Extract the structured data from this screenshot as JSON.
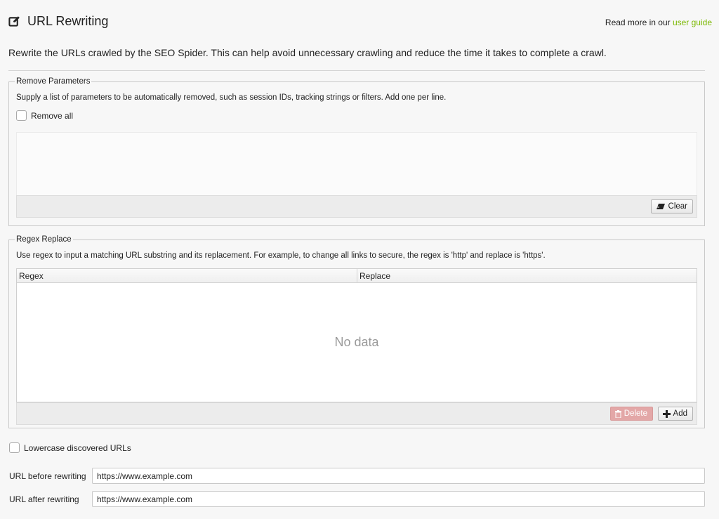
{
  "header": {
    "title": "URL Rewriting",
    "title_icon": "edit-icon",
    "read_more_prefix": "Read more in our ",
    "read_more_link": "user guide",
    "link_color": "#7ab800"
  },
  "intro": "Rewrite the URLs crawled by the SEO Spider. This can help avoid unnecessary crawling and reduce the time it takes to complete a crawl.",
  "remove_parameters": {
    "legend": "Remove Parameters",
    "description": "Supply a list of parameters to be automatically removed, such as session IDs, tracking strings or filters. Add one per line.",
    "remove_all_label": "Remove all",
    "remove_all_checked": false,
    "textarea_value": "",
    "clear_label": "Clear",
    "clear_icon": "eraser-icon"
  },
  "regex_replace": {
    "legend": "Regex Replace",
    "description": "Use regex to input a matching URL substring and its replacement. For example, to change all links to secure, the regex is 'http' and replace is 'https'.",
    "columns": [
      "Regex",
      "Replace"
    ],
    "rows": [],
    "empty_text": "No data",
    "delete_label": "Delete",
    "delete_icon": "trash-icon",
    "add_label": "Add",
    "add_icon": "plus-icon",
    "delete_color": "#e3a7a7"
  },
  "lowercase": {
    "label": "Lowercase discovered URLs",
    "checked": false
  },
  "url_before": {
    "label": "URL before rewriting",
    "value": "https://www.example.com"
  },
  "url_after": {
    "label": "URL after rewriting",
    "value": "https://www.example.com"
  }
}
